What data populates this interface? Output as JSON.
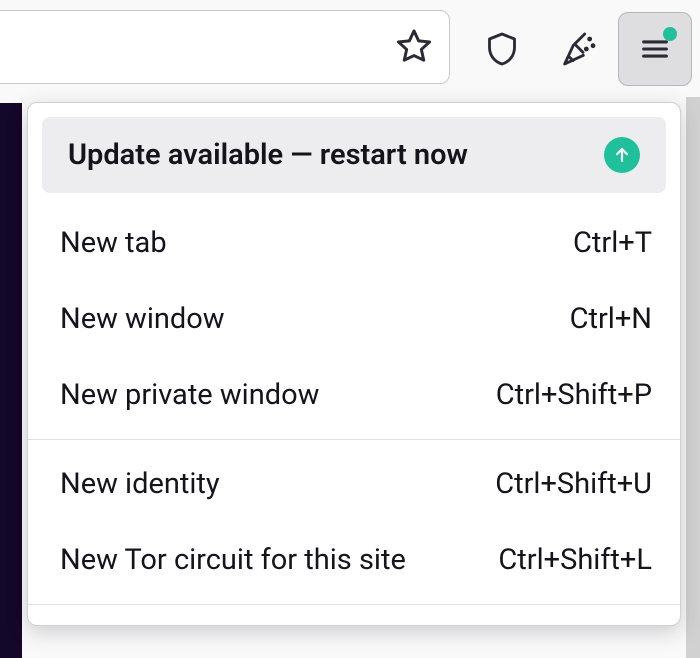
{
  "toolbar": {
    "star_icon": "star-icon",
    "shield_icon": "shield-icon",
    "broom_icon": "broom-icon",
    "hamburger_icon": "hamburger-icon"
  },
  "menu": {
    "update": {
      "label": "Update available — restart now",
      "icon": "update-arrow-icon",
      "badge_color": "#1fc19b"
    },
    "groups": [
      [
        {
          "label": "New tab",
          "shortcut": "Ctrl+T"
        },
        {
          "label": "New window",
          "shortcut": "Ctrl+N"
        },
        {
          "label": "New private window",
          "shortcut": "Ctrl+Shift+P"
        }
      ],
      [
        {
          "label": "New identity",
          "shortcut": "Ctrl+Shift+U"
        },
        {
          "label": "New Tor circuit for this site",
          "shortcut": "Ctrl+Shift+L"
        }
      ]
    ]
  }
}
